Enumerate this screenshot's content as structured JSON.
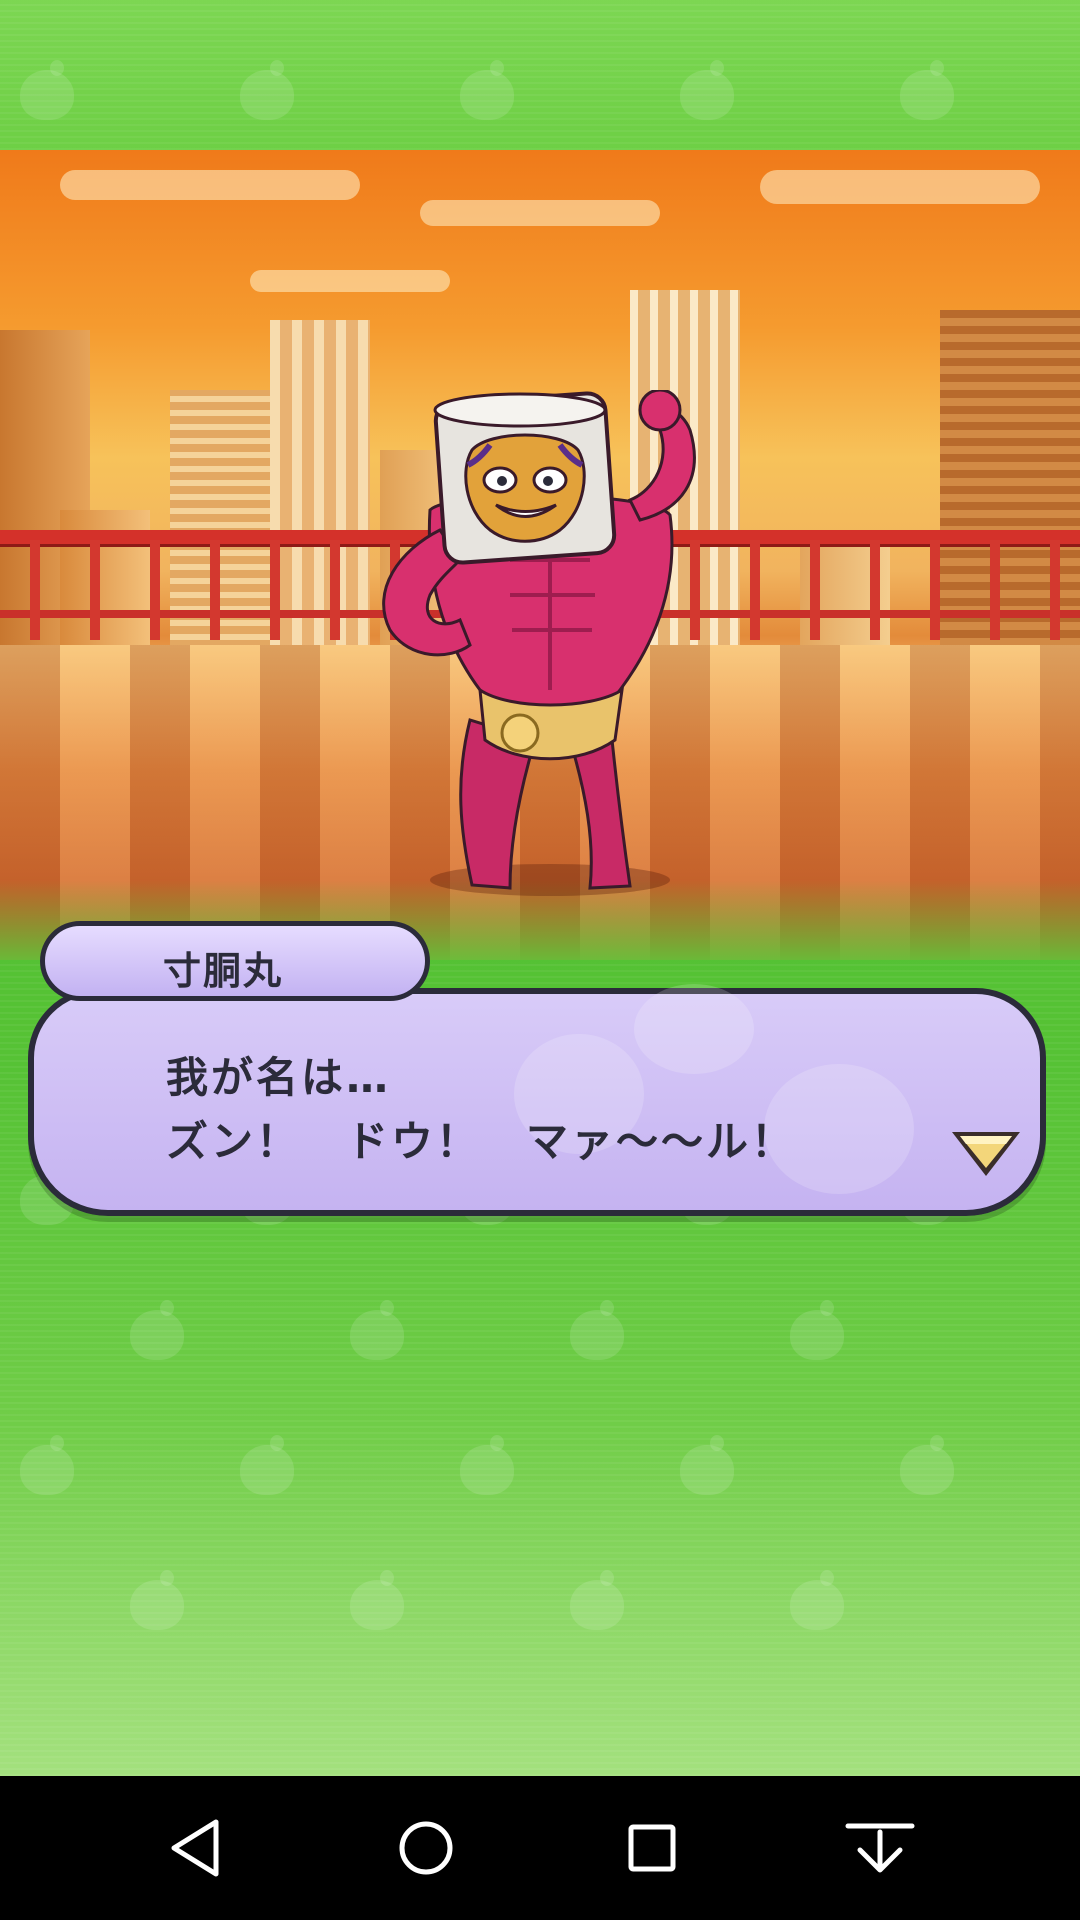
{
  "dialogue": {
    "speaker_name": "寸胴丸",
    "line1": "我が名は…",
    "line2": "ズン！　ドウ！　マァ〜〜ル！",
    "next_icon": "triangle-down-icon"
  },
  "navbar": {
    "back_icon": "back-triangle-icon",
    "home_icon": "home-circle-icon",
    "recents_icon": "recents-square-icon",
    "extra_icon": "arrow-down-bar-icon"
  },
  "colors": {
    "background_green": "#62c43a",
    "bubble_lavender": "#c9b8f3",
    "outline": "#2b2b3a",
    "muscle_pink": "#d8306e"
  }
}
